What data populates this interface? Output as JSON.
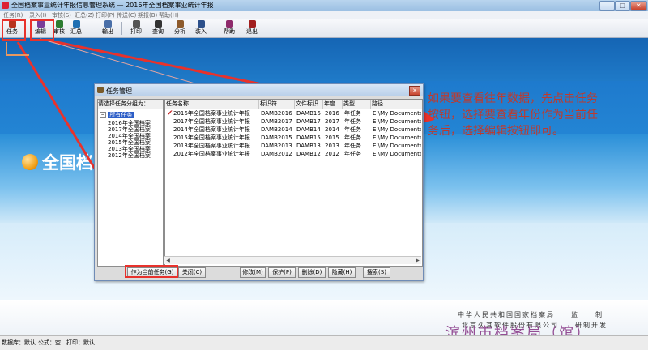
{
  "window": {
    "title": "全国档案事业统计年报信息管理系统 — 2016年全国档案事业统计年报",
    "controls": [
      "—",
      "□",
      "✕"
    ]
  },
  "menu": [
    "任务(R)",
    "录入(I)",
    "审核(S)",
    "汇总(Z)",
    "打印(P)",
    "传送(C)",
    "期报(B)",
    "帮助(H)"
  ],
  "toolbar": [
    {
      "label": "任务",
      "icon": "task-icon"
    },
    {
      "label": "编辑",
      "icon": "edit-icon"
    },
    {
      "label": "审核",
      "icon": "audit-icon"
    },
    {
      "label": "汇总",
      "icon": "summary-icon"
    },
    {
      "label": "输出",
      "icon": "export-icon"
    },
    {
      "label": "打印",
      "icon": "print-icon"
    },
    {
      "label": "查询",
      "icon": "query-icon"
    },
    {
      "label": "分析",
      "icon": "analysis-icon"
    },
    {
      "label": "装入",
      "icon": "load-icon"
    },
    {
      "label": "帮助",
      "icon": "help-icon"
    },
    {
      "label": "退出",
      "icon": "exit-icon"
    }
  ],
  "brand": {
    "text": "全国档"
  },
  "annotation": "如果要查看往年数据，先点击任务按钮，选择要查看年份作为当前任务后，选择编辑按钮即可。",
  "dialog": {
    "title": "任务管理",
    "left_header": "请选择任务分组为：",
    "tree_root": "所有任务",
    "tree_items": [
      "2016年全国档案",
      "2017年全国档案",
      "2014年全国档案",
      "2015年全国档案",
      "2013年全国档案",
      "2012年全国档案"
    ],
    "columns": [
      "任务名称",
      "标识符",
      "文件标识",
      "年度",
      "类型",
      "路径"
    ],
    "rows": [
      {
        "name": "2016年全国档案事业统计年报",
        "id": "DAMB2016",
        "file": "DAMB16",
        "year": "2016",
        "type": "年任务",
        "path": "E:\\My Documents\\全",
        "current": true
      },
      {
        "name": "2017年全国档案事业统计年报",
        "id": "DAMB2017",
        "file": "DAMB17",
        "year": "2017",
        "type": "年任务",
        "path": "E:\\My Documents\\全",
        "current": false
      },
      {
        "name": "2014年全国档案事业统计年报",
        "id": "DAMB2014",
        "file": "DAMB14",
        "year": "2014",
        "type": "年任务",
        "path": "E:\\My Documents\\全",
        "current": false
      },
      {
        "name": "2015年全国档案事业统计年报",
        "id": "DAMB2015",
        "file": "DAMB15",
        "year": "2015",
        "type": "年任务",
        "path": "E:\\My Documents\\全",
        "current": false
      },
      {
        "name": "2013年全国档案事业统计年报",
        "id": "DAMB2013",
        "file": "DAMB13",
        "year": "2013",
        "type": "年任务",
        "path": "E:\\My Documents\\全",
        "current": false
      },
      {
        "name": "2012年全国档案事业统计年报",
        "id": "DAMB2012",
        "file": "DAMB12",
        "year": "2012",
        "type": "年任务",
        "path": "E:\\My Documents\\全",
        "current": false
      }
    ],
    "buttons": {
      "set_current": "作为当前任务(G)",
      "close": "关闭(C)",
      "modify": "修改(M)",
      "protect": "保护(P)",
      "delete": "删除(D)",
      "hide": "隐藏(H)",
      "search": "搜索(S)"
    }
  },
  "footer": {
    "line1": "中华人民共和国国家档案局　　监　　制",
    "line2": "北京久其软件股份有限公司　　研制开发"
  },
  "watermark": "滨州市档案局（馆）",
  "statusbar": [
    "数据库：默认",
    "公式：空",
    "打印：默认"
  ],
  "colors": {
    "highlight": "#e8322c",
    "annotation": "#c0392b",
    "watermark": "#8a3c8a"
  }
}
